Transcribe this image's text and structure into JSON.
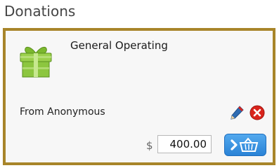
{
  "page": {
    "title": "Donations"
  },
  "donation": {
    "fund_name": "General Operating",
    "donor_text": "From Anonymous",
    "currency_symbol": "$",
    "amount": "400.00"
  },
  "icons": {
    "gift": "gift-icon",
    "edit": "pencil-icon",
    "delete": "delete-icon",
    "add_to_cart": "cart-icon"
  },
  "colors": {
    "card_border": "#a8852a",
    "gift_green": "#8cc63f",
    "delete_red": "#d9241c",
    "button_blue": "#2a83d6"
  }
}
